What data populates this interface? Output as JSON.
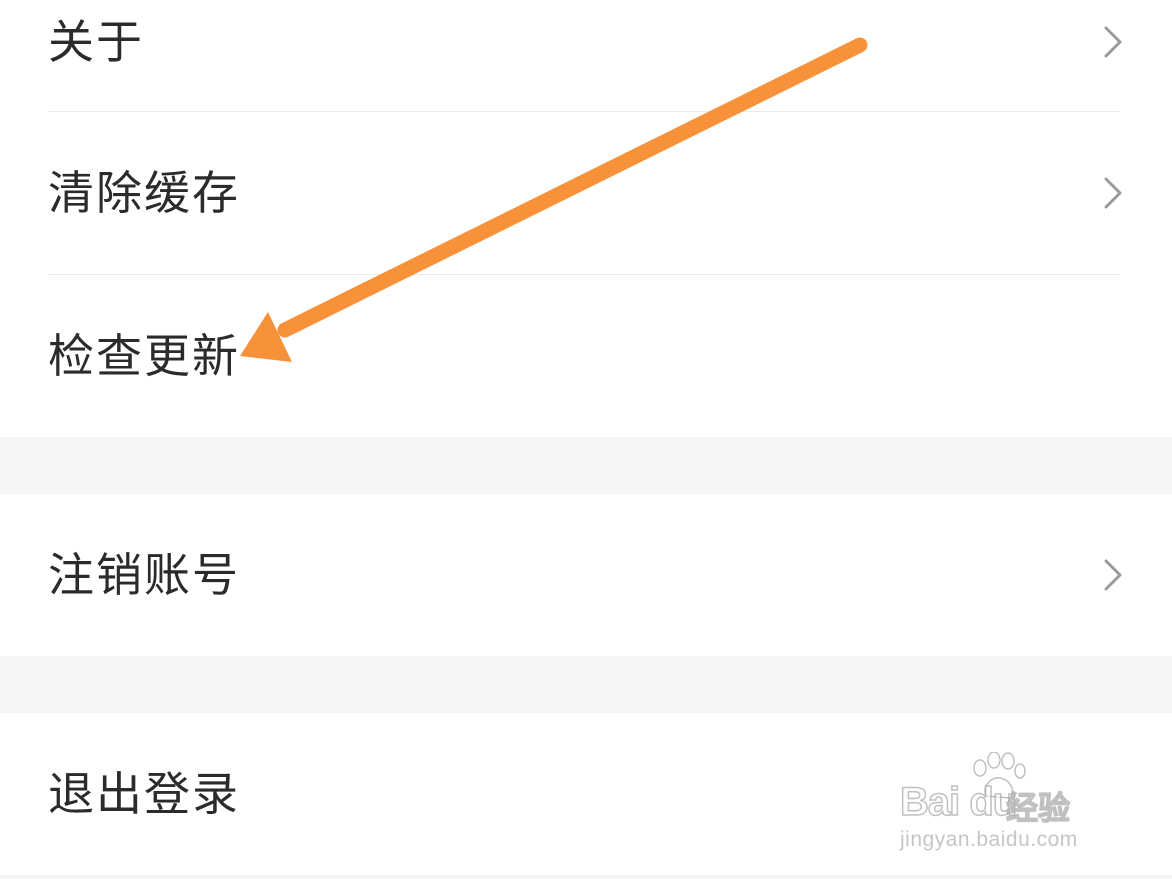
{
  "settings": {
    "items": [
      {
        "label": "关于",
        "has_chevron": true
      },
      {
        "label": "清除缓存",
        "has_chevron": true
      },
      {
        "label": "检查更新",
        "has_chevron": false
      },
      {
        "label": "注销账号",
        "has_chevron": true
      },
      {
        "label": "退出登录",
        "has_chevron": false
      }
    ]
  },
  "annotation": {
    "arrow_color": "#f7923a",
    "target": "检查更新"
  },
  "watermark": {
    "brand": "Bai du",
    "sub": "经验",
    "url": "jingyan.baidu.com"
  },
  "colors": {
    "background": "#f5f5f5",
    "row_background": "#ffffff",
    "text": "#2b2b2b",
    "chevron": "#9a9a9a",
    "divider": "#ececec"
  }
}
